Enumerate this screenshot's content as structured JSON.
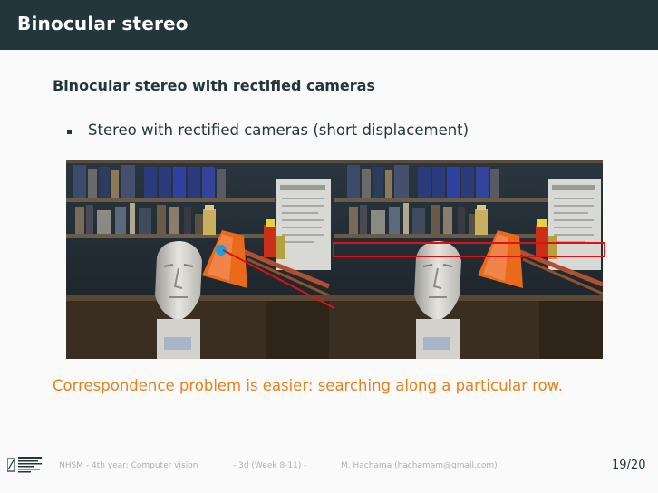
{
  "frame_title": "Binocular stereo",
  "block_title": "Binocular stereo with rectified cameras",
  "bullets": [
    "Stereo with rectified cameras (short displacement)"
  ],
  "images": {
    "left_alt": "Stereo image, left camera",
    "right_alt": "Stereo image, right camera"
  },
  "highlight": {
    "point_color": "#1aa0e0",
    "row_color": "#e01010",
    "line_color": "#e01010"
  },
  "correspondence_text": "Correspondence problem is easier: searching along a particular row.",
  "footer": {
    "course": "NHSM - 4th year: Computer vision",
    "week": "- 3d (Week 8-11) -",
    "author": "M. Hachama (hachamam@gmail.com)",
    "page": "19/20"
  },
  "colors": {
    "header_bg": "#23373b",
    "accent": "#eb811b",
    "text": "#23373b"
  }
}
